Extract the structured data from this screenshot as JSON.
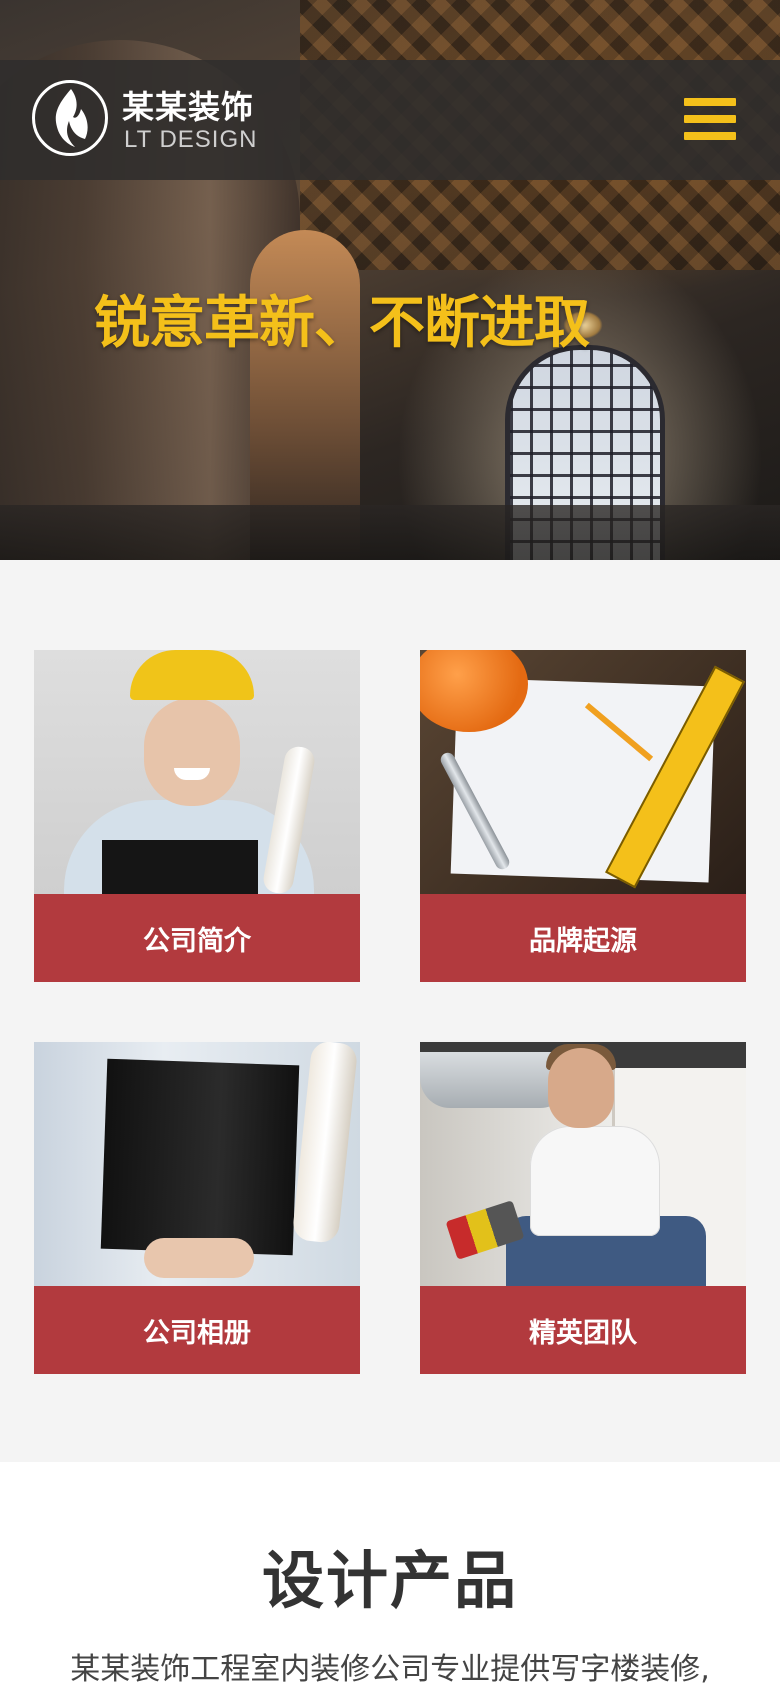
{
  "header": {
    "brand_name": "某某装饰",
    "brand_sub": "LT DESIGN",
    "logo_icon": "flame-icon",
    "menu_icon": "hamburger-menu-icon"
  },
  "hero": {
    "slogan": "锐意革新、不断进取"
  },
  "cards": [
    {
      "label": "公司简介"
    },
    {
      "label": "品牌起源"
    },
    {
      "label": "公司相册"
    },
    {
      "label": "精英团队"
    }
  ],
  "products": {
    "title": "设计产品",
    "description": "某某装饰工程室内装修公司专业提供写字楼装修,"
  },
  "colors": {
    "accent_yellow": "#f4c01a",
    "card_red": "#b23a3e",
    "topbar": "#302e2c"
  }
}
